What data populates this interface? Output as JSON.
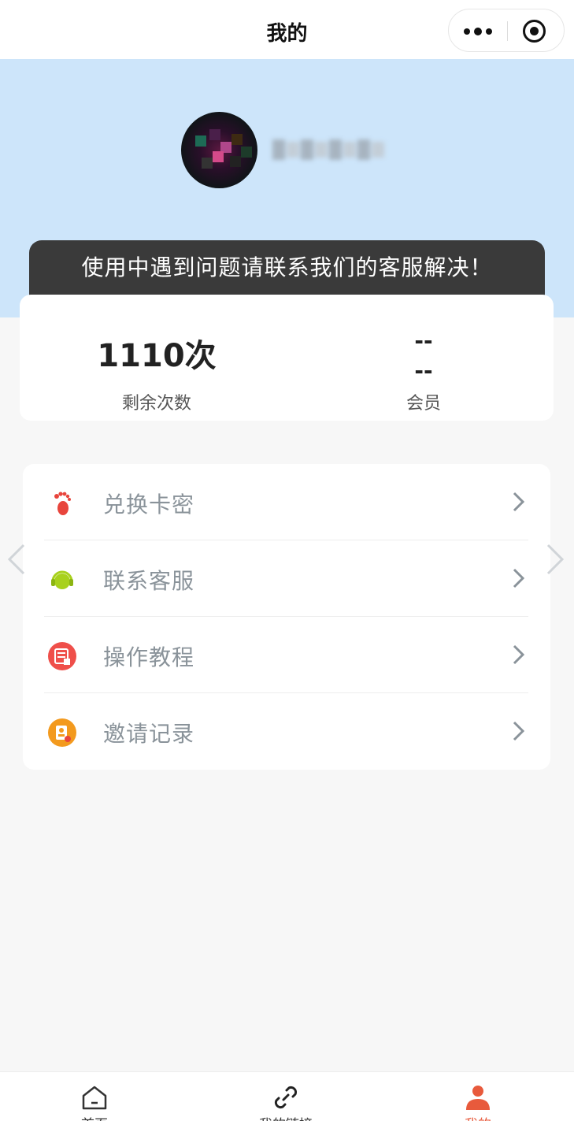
{
  "navbar": {
    "title": "我的",
    "more_icon": "more-dots-icon",
    "close_icon": "record-target-icon"
  },
  "profile": {
    "avatar_icon": "avatar",
    "nickname": ""
  },
  "notice": {
    "text": "使用中遇到问题请联系我们的客服解决！"
  },
  "stats": {
    "remaining": {
      "value": "1110次",
      "label": "剩余次数"
    },
    "membership": {
      "value_line1": "--",
      "value_line2": "--",
      "label": "会员"
    }
  },
  "menu": {
    "items": [
      {
        "label": "兑换卡密",
        "icon": "footprint-icon",
        "color": "#e8453c"
      },
      {
        "label": "联系客服",
        "icon": "headset-icon",
        "color": "#a8d11d"
      },
      {
        "label": "操作教程",
        "icon": "tutorial-icon",
        "color": "#ef4f4a"
      },
      {
        "label": "邀请记录",
        "icon": "invite-record-icon",
        "color": "#f39a1e"
      }
    ]
  },
  "tabbar": {
    "items": [
      {
        "label": "首页",
        "icon": "home-icon"
      },
      {
        "label": "我的链接",
        "icon": "link-icon"
      },
      {
        "label": "我的",
        "icon": "user-icon",
        "active": true
      }
    ]
  },
  "colors": {
    "header_bg": "#cde5fa",
    "notice_bg": "#3a3a3a",
    "page_bg": "#f7f7f7",
    "active_tab": "#e85a3c"
  }
}
